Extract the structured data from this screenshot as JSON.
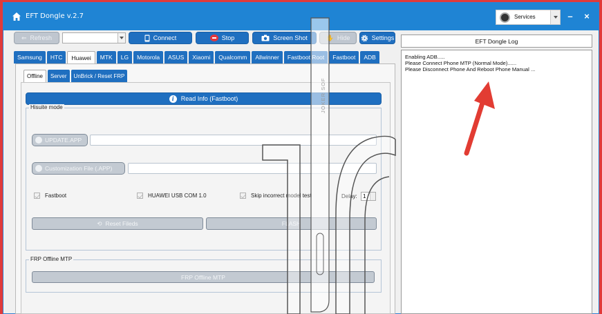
{
  "app": {
    "title": "EFT Dongle  v.2.7",
    "services_label": "Services",
    "minimize_label": "–",
    "close_label": "×"
  },
  "toolbar": {
    "refresh_label": "Refresh",
    "port_value": "",
    "connect_label": "Connect",
    "stop_label": "Stop",
    "screenshot_label": "Screen Shot",
    "hide_label": "Hide",
    "settings_label": "Settings"
  },
  "brand_tabs": [
    {
      "label": "Samsung"
    },
    {
      "label": "HTC"
    },
    {
      "label": "Huawei",
      "active": true
    },
    {
      "label": "MTK"
    },
    {
      "label": "LG"
    },
    {
      "label": "Motorola"
    },
    {
      "label": "ASUS"
    },
    {
      "label": "Xiaomi"
    },
    {
      "label": "Qualcomm"
    },
    {
      "label": "Allwinner"
    },
    {
      "label": "Fastboot Root"
    },
    {
      "label": "Fastboot"
    },
    {
      "label": "ADB"
    }
  ],
  "sub_tabs": [
    {
      "label": "Offline",
      "active": true
    },
    {
      "label": "Server"
    },
    {
      "label": "UnBrick / Reset FRP"
    }
  ],
  "offline": {
    "read_info_label": "Read Info (Fastboot)",
    "hisuite_legend": "Hisuite mode",
    "update_app_label": "UPDATE.APP",
    "update_app_value": "",
    "custom_file_label": "Customization File (.APP)",
    "custom_file_value": "",
    "fastboot_label": "Fastboot",
    "huawei_usb_label": "HUAWEI USB COM 1.0",
    "skip_test_label": "Skip incorrect model test",
    "delay_label": "Delay:",
    "delay_value": "1",
    "reset_label": "Reset Fileds",
    "flash_label": "FLASH",
    "frp_legend": "FRP Offline MTP",
    "frp_button_label": "FRP Offline MTP"
  },
  "log": {
    "title": "EFT Dongle Log",
    "lines": [
      "Enabling ADB.....",
      "Please Connect Phone MTP (Normal Mode)......",
      "Please Disconnect Phone And Reboot Phone Manual ..."
    ]
  },
  "watermark": {
    "text": "JOKER SOF"
  },
  "colors": {
    "accent": "#1f84d4",
    "button_blue": "#1f6fc0",
    "outer_frame": "#e03a3a",
    "arrow": "#e23c33",
    "stop_icon": "#e2363d"
  }
}
